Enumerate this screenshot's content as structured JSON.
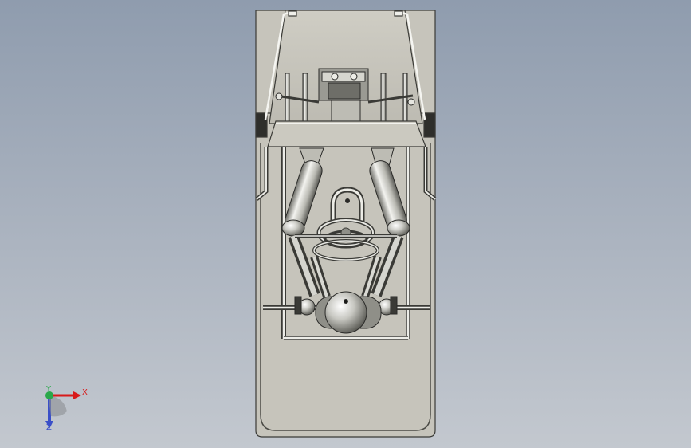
{
  "viewport": {
    "background_top": "#8f9cae",
    "background_bottom": "#c3c8cf",
    "model_fill": "#c9c8bf",
    "model_stroke": "#3a3a36",
    "chrome_light": "#f2f2ee",
    "chrome_dark": "#5c5c58"
  },
  "triad": {
    "x_label": "X",
    "y_label": "Y",
    "z_label": "Z",
    "x_color": "#d81a1a",
    "y_color": "#2aa84a",
    "z_color": "#3a4fc8"
  }
}
